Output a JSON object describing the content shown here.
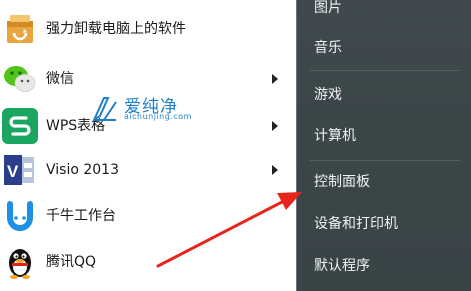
{
  "programs": [
    {
      "label": "强力卸载电脑上的软件",
      "icon": "uninstall-box-icon",
      "has_arrow": false
    },
    {
      "label": "微信",
      "icon": "wechat-icon",
      "has_arrow": true
    },
    {
      "label": "WPS表格",
      "icon": "wps-sheet-icon",
      "has_arrow": true
    },
    {
      "label": "Visio 2013",
      "icon": "visio-icon",
      "has_arrow": true
    },
    {
      "label": "千牛工作台",
      "icon": "qianniu-icon",
      "has_arrow": false
    },
    {
      "label": "腾讯QQ",
      "icon": "qq-penguin-icon",
      "has_arrow": false
    }
  ],
  "right_menu": [
    {
      "label": "图片"
    },
    {
      "label": "音乐"
    },
    {
      "label": "游戏"
    },
    {
      "label": "计算机"
    },
    {
      "label": "控制面板"
    },
    {
      "label": "设备和打印机"
    },
    {
      "label": "默认程序"
    }
  ],
  "watermark": {
    "text": "爱纯净",
    "subtext": "aichunjing.com"
  },
  "colors": {
    "right_pane_bg": "#3d484b",
    "arrow_red": "#e8251c",
    "watermark_blue": "#1f7fc9"
  }
}
